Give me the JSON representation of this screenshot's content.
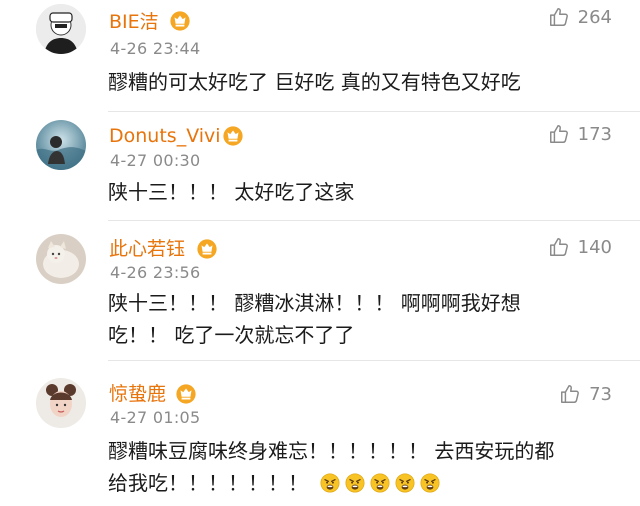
{
  "comments": [
    {
      "username": "BIE洁",
      "time": "4-26 23:44",
      "likes": "264",
      "lines": [
        "醪糟的可太好吃了 巨好吃 真的又有特色又好吃"
      ]
    },
    {
      "username": "Donuts_Vivi",
      "time": "4-27 00:30",
      "likes": "173",
      "lines": [
        "陕十三！！！ 太好吃了这家"
      ]
    },
    {
      "username": "此心若钰",
      "time": "4-26 23:56",
      "likes": "140",
      "lines": [
        "陕十三！！！ 醪糟冰淇淋！！！ 啊啊啊我好想",
        "吃！！ 吃了一次就忘不了了"
      ]
    },
    {
      "username": "惊蛰鹿",
      "time": "4-27 01:05",
      "likes": "73",
      "lines": [
        "醪糟味豆腐味终身难忘！！！！！！ 去西安玩的都",
        "给我吃！！！！！！！"
      ],
      "emojis": [
        "angry-face-icon",
        "angry-face-icon",
        "angry-face-icon",
        "angry-face-icon",
        "angry-face-icon"
      ]
    }
  ],
  "colors": {
    "username": "#e8740c",
    "meta": "#8a8a8a",
    "text": "#1b1b1b",
    "divider": "#e6e6e6",
    "badge": "#f5a623"
  }
}
